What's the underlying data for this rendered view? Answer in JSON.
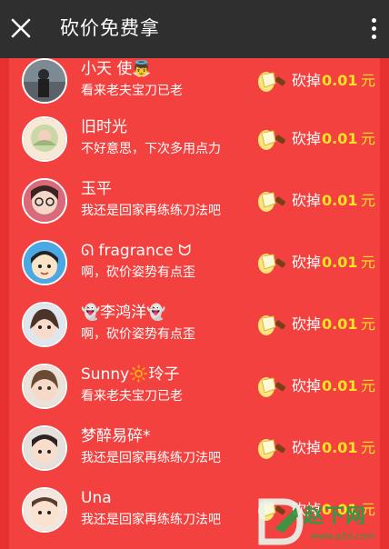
{
  "header": {
    "title": "砍价免费拿"
  },
  "rows": [
    {
      "name": "小天 使👼",
      "message": "看来老夫宝刀已老",
      "cut_label": "砍掉",
      "cut_amount": "0.01",
      "cut_unit": "元"
    },
    {
      "name": "旧时光",
      "message": "不好意思，下次多用点力",
      "cut_label": "砍掉",
      "cut_amount": "0.01",
      "cut_unit": "元"
    },
    {
      "name": "玉平",
      "message": "我还是回家再练练刀法吧",
      "cut_label": "砍掉",
      "cut_amount": "0.01",
      "cut_unit": "元"
    },
    {
      "name": "ᘏ fragrance ᗢ",
      "message": "啊，砍价姿势有点歪",
      "cut_label": "砍掉",
      "cut_amount": "0.01",
      "cut_unit": "元"
    },
    {
      "name": "👻李鸿洋👻",
      "message": "啊，砍价姿势有点歪",
      "cut_label": "砍掉",
      "cut_amount": "0.01",
      "cut_unit": "元"
    },
    {
      "name": "Sunny🔆玲子",
      "message": "看来老夫宝刀已老",
      "cut_label": "砍掉",
      "cut_amount": "0.01",
      "cut_unit": "元"
    },
    {
      "name": "梦醉易碎*",
      "message": "我还是回家再练练刀法吧",
      "cut_label": "砍掉",
      "cut_amount": "0.01",
      "cut_unit": "元"
    },
    {
      "name": "Una",
      "message": "我还是回家再练练刀法吧",
      "cut_label": "砍掉",
      "cut_amount": "0.01",
      "cut_unit": "元"
    }
  ],
  "watermark": {
    "text": "赵下网",
    "url": "www.q2d.com"
  },
  "colors": {
    "header_bg": "#2f2f30",
    "list_bg": "#f2413f",
    "amount": "#ffe325"
  },
  "icons": {
    "close": "close-icon",
    "more": "more-vertical-icon",
    "knife": "knife-icon"
  }
}
